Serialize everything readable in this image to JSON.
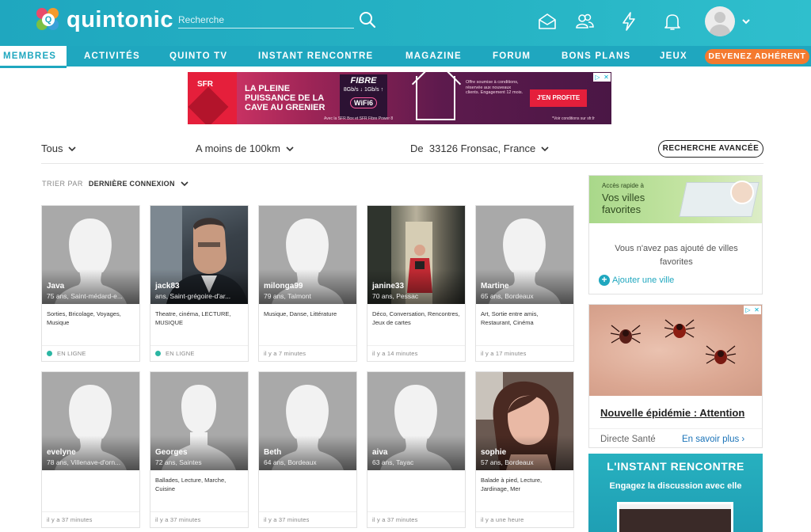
{
  "brand": {
    "name": "quintonic",
    "logo_letter": "Q"
  },
  "search": {
    "placeholder": "Recherche"
  },
  "header_icons": [
    "mail-icon",
    "friends-icon",
    "flash-icon",
    "bell-icon"
  ],
  "nav": {
    "items": [
      "MEMBRES",
      "ACTIVITÉS",
      "QUINTO TV",
      "INSTANT RENCONTRE",
      "MAGAZINE",
      "FORUM",
      "BONS PLANS",
      "JEUX"
    ],
    "active": "MEMBRES",
    "cta": "DEVENEZ ADHÉRENT"
  },
  "banner_ad": {
    "brand": "SFR",
    "headline": "LA PLEINE PUISSANCE DE LA CAVE AU GRENIER",
    "fibre": "FIBRE",
    "speed": "8Gb/s ↓ 1Gb/s ↑",
    "wifi": "WiFi6",
    "fine_print": "Offre soumise à conditions, réservée aux nouveaux clients. Engagement 12 mois.",
    "cta": "J'EN PROFITE",
    "footnote": "Avec la SFR Box et SFR Fibre Power 8",
    "conditions": "*Voir conditions sur sfr.fr"
  },
  "filters": {
    "who": "Tous",
    "distance": "A moins de 100km",
    "location_prefix": "De",
    "location": "33126 Fronsac, France",
    "advanced": "RECHERCHE AVANCÉE"
  },
  "sort": {
    "label": "TRIER PAR",
    "value": "DERNIÈRE CONNEXION"
  },
  "members": [
    {
      "name": "Java",
      "meta": "75 ans, Saint-médard-e...",
      "tags": "Sorties, Bricolage, Voyages, Musique",
      "status": "EN LIGNE",
      "online": true,
      "photo": "female"
    },
    {
      "name": "jack83",
      "meta": "ans, Saint-grégoire-d'ar...",
      "tags": "Theatre, cinéma, LECTURE, MUSIQUE",
      "status": "EN LIGNE",
      "online": true,
      "photo": "jack"
    },
    {
      "name": "milonga99",
      "meta": "79 ans, Talmont",
      "tags": "Musique, Danse, Littérature",
      "status": "il y a 7 minutes",
      "online": false,
      "photo": "female"
    },
    {
      "name": "janine33",
      "meta": "70 ans, Pessac",
      "tags": "Déco, Conversation, Rencontres, Jeux de cartes",
      "status": "il y a 14 minutes",
      "online": false,
      "photo": "janine"
    },
    {
      "name": "Martine",
      "meta": "65 ans, Bordeaux",
      "tags": "Art, Sortie entre amis, Restaurant, Cinéma",
      "status": "il y a 17 minutes",
      "online": false,
      "photo": "female"
    },
    {
      "name": "evelyne",
      "meta": "78 ans, Villenave-d'orn...",
      "tags": "",
      "status": "il y a 37 minutes",
      "online": false,
      "photo": "female"
    },
    {
      "name": "Georges",
      "meta": "72 ans, Saintes",
      "tags": "Ballades, Lecture, Marche, Cuisine",
      "status": "il y a 37 minutes",
      "online": false,
      "photo": "male"
    },
    {
      "name": "Beth",
      "meta": "64 ans, Bordeaux",
      "tags": "",
      "status": "il y a 37 minutes",
      "online": false,
      "photo": "female"
    },
    {
      "name": "aiva",
      "meta": "63 ans, Tayac",
      "tags": "",
      "status": "il y a 37 minutes",
      "online": false,
      "photo": "female"
    },
    {
      "name": "sophie",
      "meta": "57 ans, Bordeaux",
      "tags": "Balade à pied, Lecture, Jardinage, Mer",
      "status": "il y a une heure",
      "online": false,
      "photo": "sophie"
    }
  ],
  "favorite_cities": {
    "kicker": "Accès rapide à",
    "title": "Vos villes favorites",
    "empty_text": "Vous n'avez pas ajouté de villes favorites",
    "add": "Ajouter une ville"
  },
  "side_ad": {
    "title": "Nouvelle épidémie : Attention",
    "source": "Directe Santé",
    "more": "En savoir plus ›"
  },
  "instant": {
    "title": "L'INSTANT RENCONTRE",
    "subtitle": "Engagez la discussion avec elle"
  },
  "colors": {
    "brand": "#1fa7bf",
    "cta": "#f47a2f",
    "online": "#2bb6a3"
  }
}
